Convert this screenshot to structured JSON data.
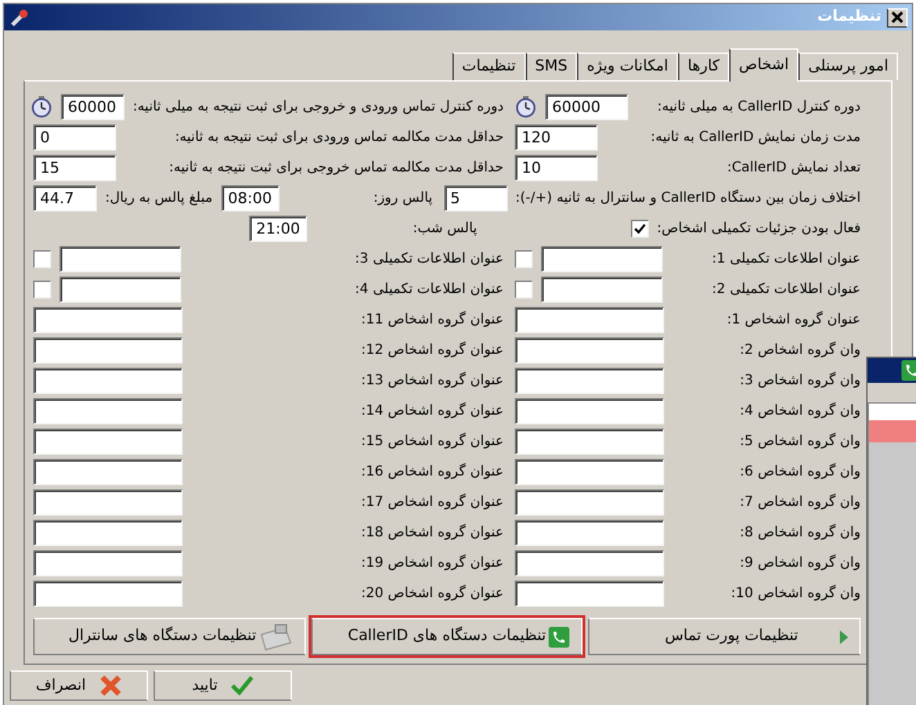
{
  "window": {
    "title": "تنظیمات"
  },
  "tabs": [
    {
      "label": "امور پرسنلی",
      "selected": false
    },
    {
      "label": "اشخاص",
      "selected": true
    },
    {
      "label": "کارها",
      "selected": false
    },
    {
      "label": "امکانات ویژه",
      "selected": false
    },
    {
      "label": "SMS",
      "selected": false
    },
    {
      "label": "تنظیمات",
      "selected": false
    }
  ],
  "rows": [
    {
      "right": [
        {
          "kind": "label",
          "text": "دوره کنترل CallerID به میلی ثانیه:"
        },
        {
          "kind": "num",
          "value": "60000"
        },
        {
          "kind": "timer"
        }
      ],
      "left": [
        {
          "kind": "label",
          "text": "دوره کنترل تماس ورودی و خروجی برای ثبت نتیجه به میلی ثانیه:"
        },
        {
          "kind": "short",
          "value": "60000"
        },
        {
          "kind": "timer"
        }
      ]
    },
    {
      "right": [
        {
          "kind": "label",
          "text": "مدت زمان نمایش CallerID به ثانیه:"
        },
        {
          "kind": "num",
          "value": "120"
        }
      ],
      "left": [
        {
          "kind": "label",
          "text": "حداقل مدت مکالمه تماس ورودی برای ثبت نتیجه به ثانیه:"
        },
        {
          "kind": "num",
          "value": "0"
        }
      ]
    },
    {
      "right": [
        {
          "kind": "label",
          "text": "تعداد نمایش CallerID:"
        },
        {
          "kind": "num",
          "value": "10"
        }
      ],
      "left": [
        {
          "kind": "label",
          "text": "حداقل مدت مکالمه تماس خروجی برای ثبت نتیجه به ثانیه:"
        },
        {
          "kind": "num",
          "value": "15"
        }
      ]
    },
    {
      "right": [
        {
          "kind": "label",
          "text": "اختلاف زمان بین دستگاه CallerID و سانترال به ثانیه (+/-):"
        },
        {
          "kind": "short",
          "value": "5"
        }
      ],
      "left": [
        {
          "kind": "label",
          "text": "پالس روز:"
        },
        {
          "kind": "time",
          "value": "08:00"
        },
        {
          "kind": "label",
          "text": "مبلغ پالس به ریال:"
        },
        {
          "kind": "short",
          "value": "44.7"
        }
      ]
    },
    {
      "right": [
        {
          "kind": "label",
          "text": "فعال بودن جزئیات تکمیلی اشخاص:"
        },
        {
          "kind": "checkbox",
          "checked": true
        },
        {
          "kind": "pad"
        }
      ],
      "left": [
        {
          "kind": "label",
          "text": "پالس شب:"
        },
        {
          "kind": "time",
          "value": "21:00"
        },
        {
          "kind": "gap"
        }
      ]
    },
    {
      "right": [
        {
          "kind": "label",
          "text": "عنوان اطلاعات تکمیلی 1:"
        },
        {
          "kind": "mid"
        },
        {
          "kind": "checkbox",
          "checked": false
        }
      ],
      "left": [
        {
          "kind": "label",
          "text": "عنوان اطلاعات تکمیلی 3:"
        },
        {
          "kind": "mid"
        },
        {
          "kind": "checkbox",
          "checked": false
        }
      ]
    },
    {
      "right": [
        {
          "kind": "label",
          "text": "عنوان اطلاعات تکمیلی 2:"
        },
        {
          "kind": "mid"
        },
        {
          "kind": "checkbox",
          "checked": false
        }
      ],
      "left": [
        {
          "kind": "label",
          "text": "عنوان اطلاعات تکمیلی 4:"
        },
        {
          "kind": "mid"
        },
        {
          "kind": "checkbox",
          "checked": false
        }
      ]
    },
    {
      "right": [
        {
          "kind": "label",
          "text": "عنوان گروه اشخاص 1:"
        },
        {
          "kind": "input"
        }
      ],
      "left": [
        {
          "kind": "label",
          "text": "عنوان گروه اشخاص 11:"
        },
        {
          "kind": "input"
        }
      ]
    },
    {
      "right": [
        {
          "kind": "label",
          "text": "وان گروه اشخاص 2:"
        },
        {
          "kind": "input"
        }
      ],
      "left": [
        {
          "kind": "label",
          "text": "عنوان گروه اشخاص 12:"
        },
        {
          "kind": "input"
        }
      ]
    },
    {
      "right": [
        {
          "kind": "label",
          "text": "وان گروه اشخاص 3:"
        },
        {
          "kind": "input"
        }
      ],
      "left": [
        {
          "kind": "label",
          "text": "عنوان گروه اشخاص 13:"
        },
        {
          "kind": "input"
        }
      ]
    },
    {
      "right": [
        {
          "kind": "label",
          "text": "وان گروه اشخاص 4:"
        },
        {
          "kind": "input"
        }
      ],
      "left": [
        {
          "kind": "label",
          "text": "عنوان گروه اشخاص 14:"
        },
        {
          "kind": "input"
        }
      ]
    },
    {
      "right": [
        {
          "kind": "label",
          "text": "وان گروه اشخاص 5:"
        },
        {
          "kind": "input"
        }
      ],
      "left": [
        {
          "kind": "label",
          "text": "عنوان گروه اشخاص 15:"
        },
        {
          "kind": "input"
        }
      ]
    },
    {
      "right": [
        {
          "kind": "label",
          "text": "وان گروه اشخاص 6:"
        },
        {
          "kind": "input"
        }
      ],
      "left": [
        {
          "kind": "label",
          "text": "عنوان گروه اشخاص 16:"
        },
        {
          "kind": "input"
        }
      ]
    },
    {
      "right": [
        {
          "kind": "label",
          "text": "وان گروه اشخاص 7:"
        },
        {
          "kind": "input"
        }
      ],
      "left": [
        {
          "kind": "label",
          "text": "عنوان گروه اشخاص 17:"
        },
        {
          "kind": "input"
        }
      ]
    },
    {
      "right": [
        {
          "kind": "label",
          "text": "وان گروه اشخاص 8:"
        },
        {
          "kind": "input"
        }
      ],
      "left": [
        {
          "kind": "label",
          "text": "عنوان گروه اشخاص 18:"
        },
        {
          "kind": "input"
        }
      ]
    },
    {
      "right": [
        {
          "kind": "label",
          "text": "وان گروه اشخاص 9:"
        },
        {
          "kind": "input"
        }
      ],
      "left": [
        {
          "kind": "label",
          "text": "عنوان گروه اشخاص 19:"
        },
        {
          "kind": "input"
        }
      ]
    },
    {
      "right": [
        {
          "kind": "label",
          "text": "وان گروه اشخاص 10:"
        },
        {
          "kind": "input"
        }
      ],
      "left": [
        {
          "kind": "label",
          "text": "عنوان گروه اشخاص 20:"
        },
        {
          "kind": "input"
        }
      ]
    }
  ],
  "device_buttons": [
    {
      "label": "تنظیمات پورت تماس",
      "selected": false,
      "kind": "port"
    },
    {
      "label": "تنظیمات دستگاه های CallerID",
      "selected": true,
      "kind": "phone"
    },
    {
      "label": "تنظیمات دستگاه های سانترال",
      "selected": false,
      "kind": "pbx"
    }
  ],
  "footer_buttons": [
    {
      "label": "تایید",
      "kind": "ok"
    },
    {
      "label": "انصراف",
      "kind": "cancel"
    }
  ]
}
